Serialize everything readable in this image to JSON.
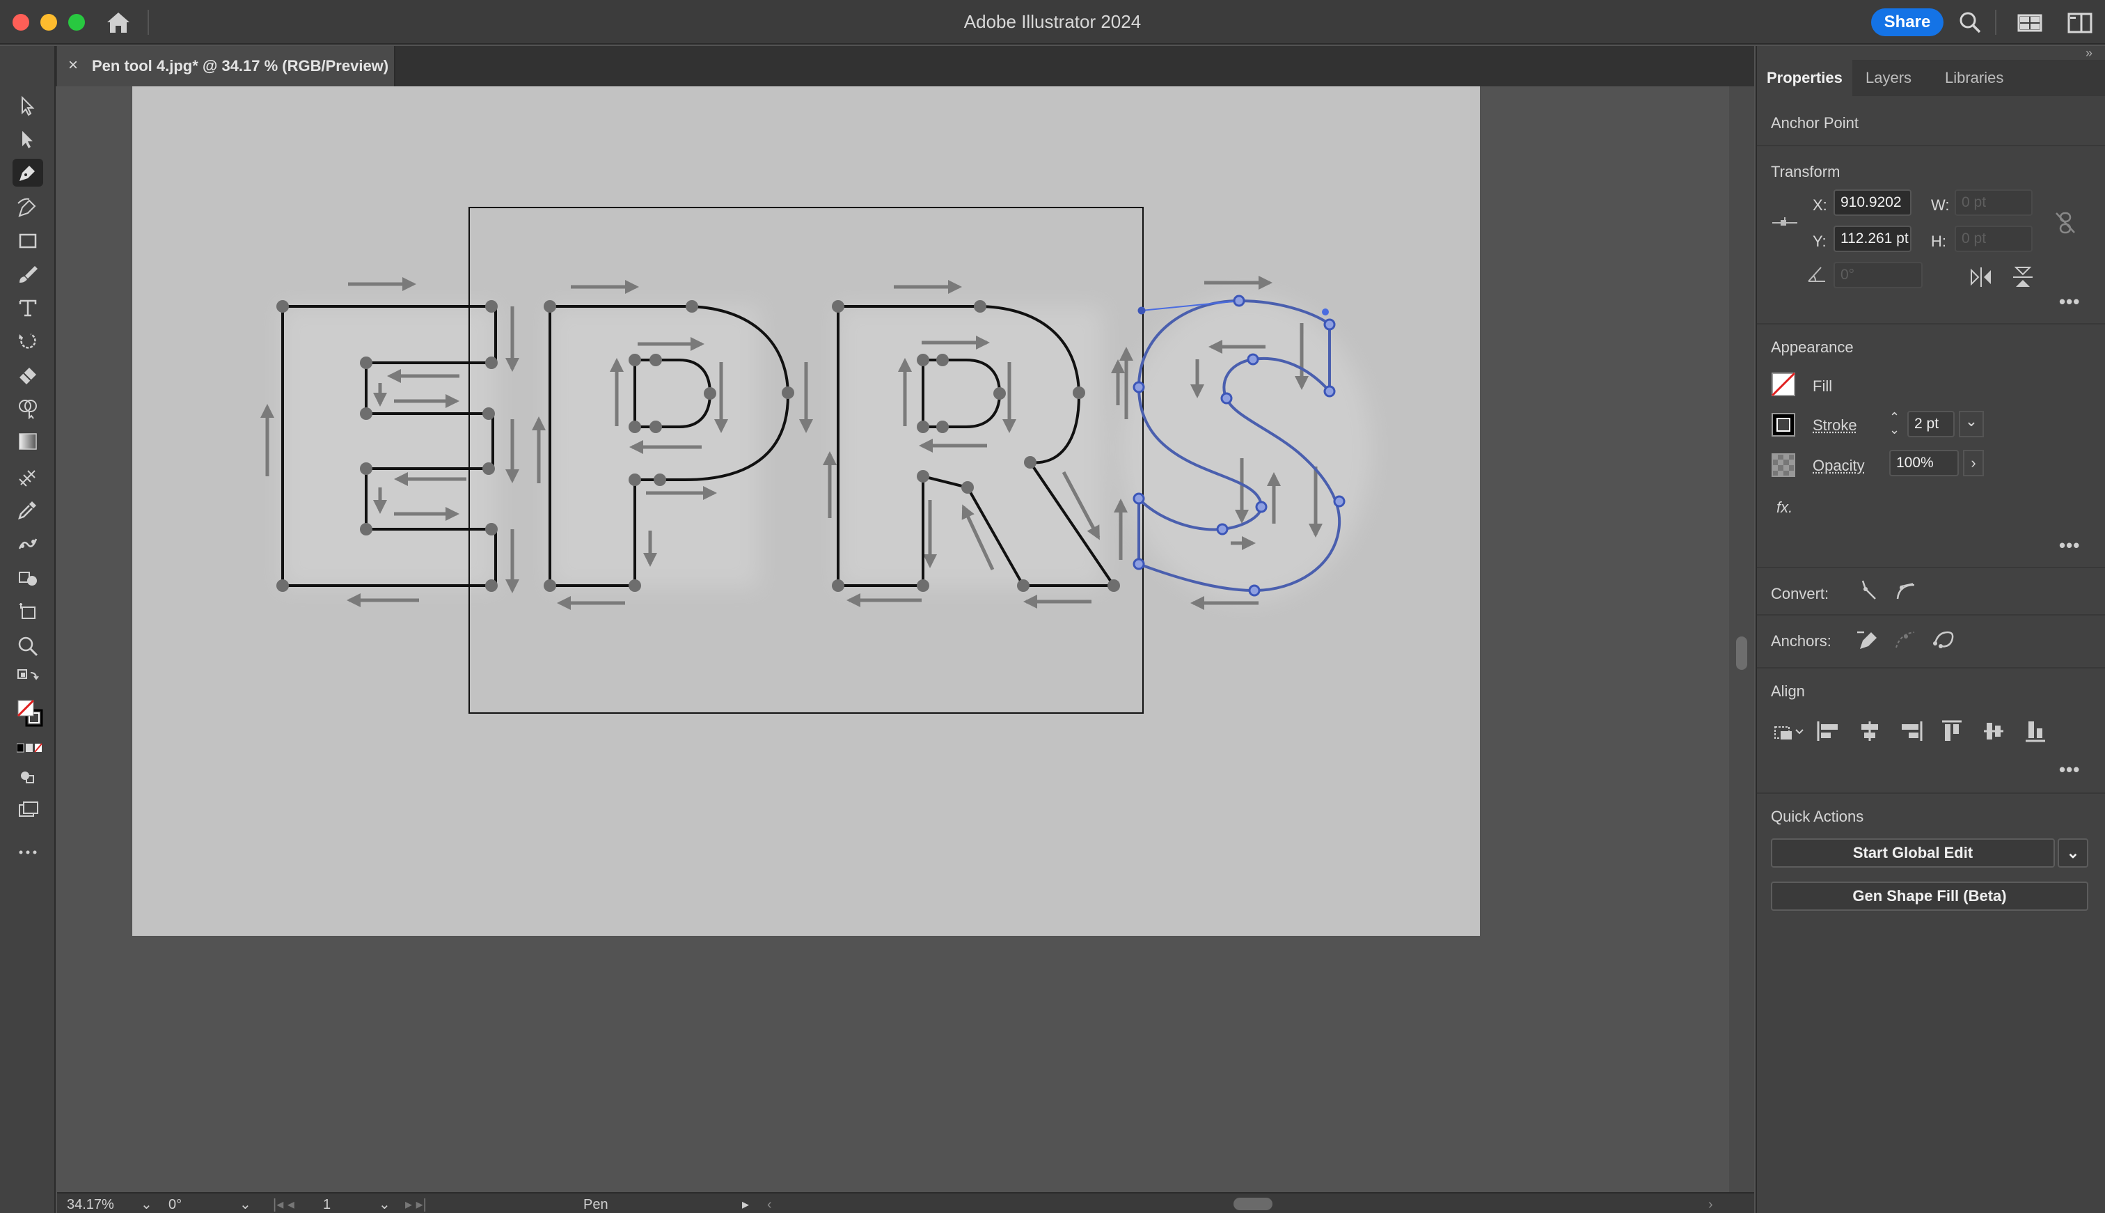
{
  "window": {
    "title": "Adobe Illustrator 2024",
    "share_label": "Share"
  },
  "document": {
    "tab_label": "Pen tool 4.jpg* @ 34.17 % (RGB/Preview)"
  },
  "toolbar": {
    "tools": [
      "selection-tool",
      "direct-selection-tool",
      "pen-tool",
      "curvature-tool",
      "rectangle-tool",
      "paintbrush-tool",
      "type-tool",
      "rotate-tool",
      "eraser-tool",
      "shape-builder-tool",
      "gradient-tool",
      "eyedropper-tool",
      "blend-tool",
      "width-tool",
      "shape-tool",
      "artboard-tool",
      "zoom-tool"
    ],
    "active_tool": "pen-tool"
  },
  "artwork": {
    "letters": [
      "E",
      "P",
      "R",
      "S"
    ]
  },
  "statusbar": {
    "zoom": "34.17%",
    "rotation": "0°",
    "artboard_number": "1",
    "current_tool": "Pen"
  },
  "panel": {
    "tabs": [
      {
        "label": "Properties",
        "active": true
      },
      {
        "label": "Layers",
        "active": false
      },
      {
        "label": "Libraries",
        "active": false
      }
    ],
    "selection_label": "Anchor Point",
    "transform": {
      "title": "Transform",
      "x_label": "X:",
      "x_value": "910.9202",
      "y_label": "Y:",
      "y_value": "112.261 pt",
      "w_label": "W:",
      "w_value": "0 pt",
      "h_label": "H:",
      "h_value": "0 pt",
      "angle_value": "0°"
    },
    "appearance": {
      "title": "Appearance",
      "fill_label": "Fill",
      "stroke_label": "Stroke",
      "stroke_value": "2 pt",
      "opacity_label": "Opacity",
      "opacity_value": "100%",
      "fx_label": "fx."
    },
    "convert_label": "Convert:",
    "anchors_label": "Anchors:",
    "align_title": "Align",
    "quick_actions": {
      "title": "Quick Actions",
      "global_edit_label": "Start Global Edit",
      "gen_fill_label": "Gen Shape Fill (Beta)"
    }
  },
  "colors": {
    "accent": "#1473e6",
    "selection_blue": "#4a5fae",
    "artboard": "#c2c2c2"
  }
}
